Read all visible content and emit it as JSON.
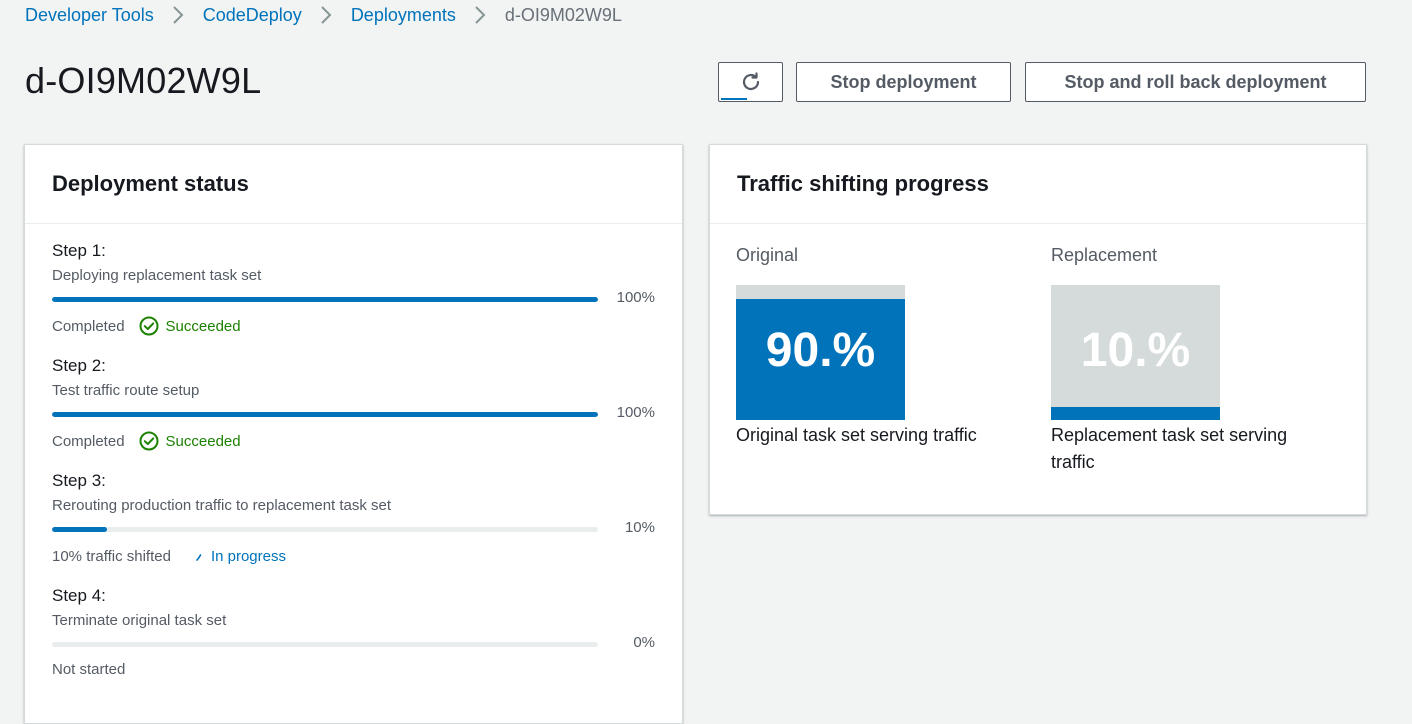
{
  "breadcrumb": {
    "items": [
      {
        "label": "Developer Tools"
      },
      {
        "label": "CodeDeploy"
      },
      {
        "label": "Deployments"
      }
    ],
    "current": "d-OI9M02W9L"
  },
  "header": {
    "title": "d-OI9M02W9L",
    "refresh_icon": "refresh-icon",
    "stop_label": "Stop deployment",
    "rollback_label": "Stop and roll back deployment"
  },
  "deployment_status": {
    "title": "Deployment status",
    "steps": [
      {
        "title": "Step 1:",
        "description": "Deploying replacement task set",
        "progress": 100,
        "progress_label": "100%",
        "state_text": "Completed",
        "status": "Succeeded",
        "status_icon": "check-circle-icon"
      },
      {
        "title": "Step 2:",
        "description": "Test traffic route setup",
        "progress": 100,
        "progress_label": "100%",
        "state_text": "Completed",
        "status": "Succeeded",
        "status_icon": "check-circle-icon"
      },
      {
        "title": "Step 3:",
        "description": "Rerouting production traffic to replacement task set",
        "progress": 10,
        "progress_label": "10%",
        "state_text": "10% traffic shifted",
        "status": "In progress",
        "status_icon": "spinner-icon"
      },
      {
        "title": "Step 4:",
        "description": "Terminate original task set",
        "progress": 0,
        "progress_label": "0%",
        "state_text": "Not started",
        "status": "",
        "status_icon": ""
      }
    ]
  },
  "traffic_shifting": {
    "title": "Traffic shifting progress",
    "original": {
      "label": "Original",
      "value": "90.%",
      "percent": 90,
      "caption": "Original task set serving traffic"
    },
    "replacement": {
      "label": "Replacement",
      "value": "10.%",
      "percent": 10,
      "caption": "Replacement task set serving traffic"
    }
  },
  "colors": {
    "accent": "#0073bb",
    "success": "#1d8102",
    "background": "#f2f3f3",
    "track": "#eaeded",
    "empty_fill": "#d5dbdb"
  }
}
